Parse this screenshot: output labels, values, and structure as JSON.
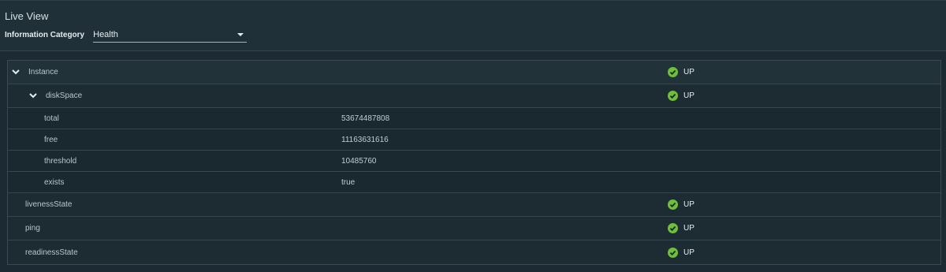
{
  "header": {
    "title": "Live View",
    "filter_label": "Information Category",
    "category_selected": "Health"
  },
  "colors": {
    "up_green": "#6fbf3a"
  },
  "rows": [
    {
      "name": "Instance",
      "status": "UP"
    },
    {
      "name": "diskSpace",
      "status": "UP"
    },
    {
      "name": "total",
      "value": "53674487808"
    },
    {
      "name": "free",
      "value": "11163631616"
    },
    {
      "name": "threshold",
      "value": "10485760"
    },
    {
      "name": "exists",
      "value": "true"
    },
    {
      "name": "livenessState",
      "status": "UP"
    },
    {
      "name": "ping",
      "status": "UP"
    },
    {
      "name": "readinessState",
      "status": "UP"
    }
  ],
  "icons": {
    "expand": "chevron-down-icon",
    "status": "check-circle-icon"
  }
}
